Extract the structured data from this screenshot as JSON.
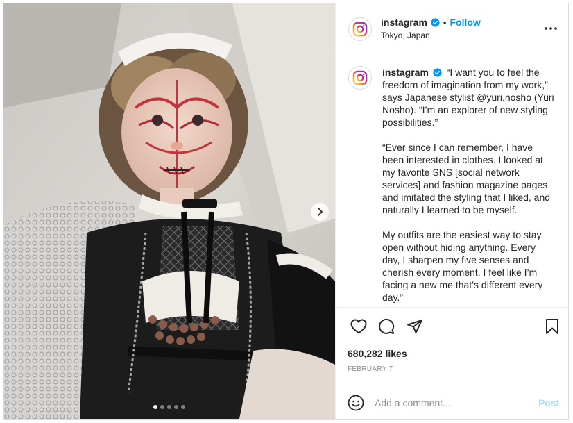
{
  "post": {
    "username": "instagram",
    "verified": true,
    "follow_label": "Follow",
    "separator": "•",
    "location": "Tokyo, Japan"
  },
  "caption": {
    "username": "instagram",
    "paragraphs": [
      "“I want you to feel the freedom of imagination from my work,” says Japanese stylist @yuri.nosho (Yuri Nosho). “I’m an explorer of new styling possibilities.”",
      "“Ever since I can remember, I have been interested in clothes. I looked at my favorite SNS [social network services] and fashion magazine pages and imitated the styling that I liked, and naturally I learned to be myself.",
      "My outfits are the easiest way to stay open without hiding anything. Every day, I sharpen my five senses and cherish every moment. I feel like I’m facing a new me that’s different every day.”"
    ]
  },
  "stats": {
    "likes": "680,282 likes",
    "date": "FEBRUARY 7"
  },
  "comment": {
    "placeholder": "Add a comment...",
    "post_label": "Post"
  },
  "carousel": {
    "slide_count": 5,
    "active_index": 0
  },
  "icons": {
    "more": "more-options-icon",
    "like": "heart-icon",
    "comment": "comment-icon",
    "share": "share-icon",
    "save": "bookmark-icon",
    "emoji": "emoji-icon",
    "next": "chevron-right-icon"
  },
  "colors": {
    "link": "#0095f6",
    "post_disabled": "#b3dbff",
    "border": "#dbdbdb",
    "muted": "#8e8e8e"
  }
}
